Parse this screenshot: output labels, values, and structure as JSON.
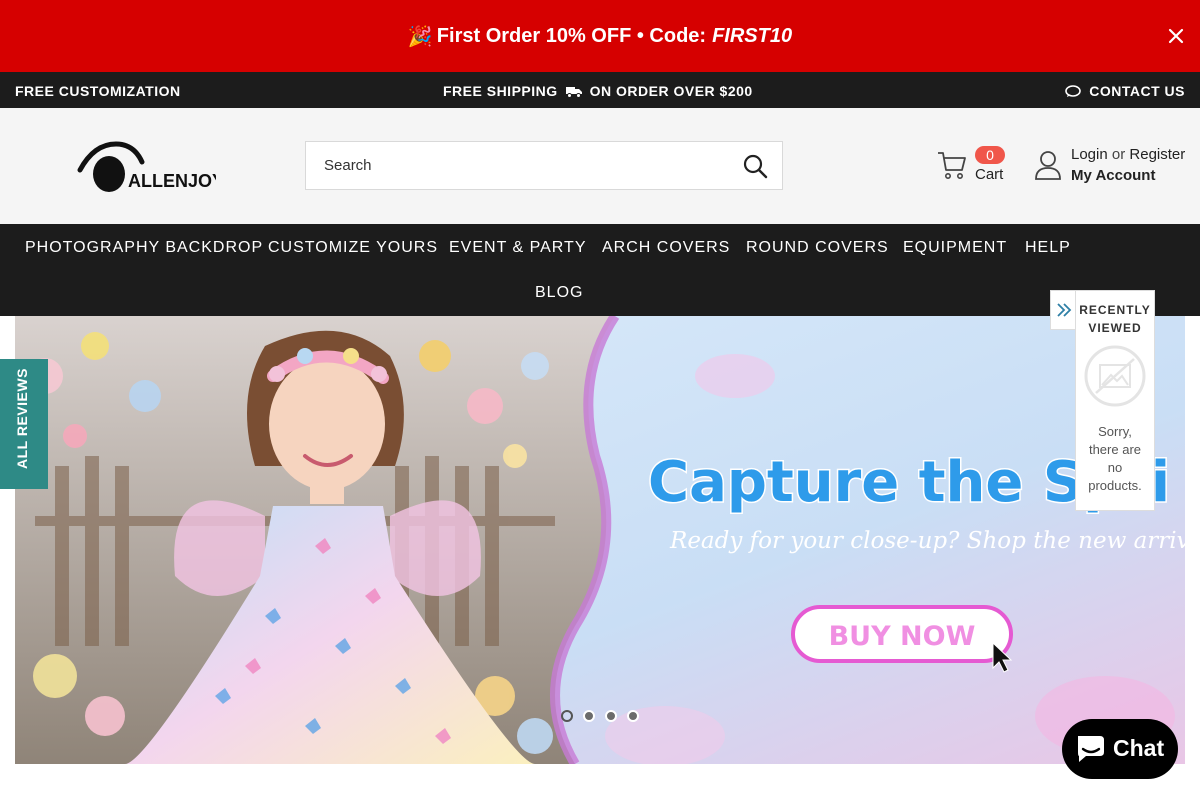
{
  "promo": {
    "emoji": "🎉",
    "text": "First Order 10% OFF • Code:",
    "code": "FIRST10",
    "bg_color": "#d60000"
  },
  "utility": {
    "left": "FREE CUSTOMIZATION",
    "center_a": "FREE SHIPPING",
    "center_b": "ON ORDER OVER $200",
    "right": "CONTACT US"
  },
  "header": {
    "logo_text": "ALLENJOY",
    "search_placeholder": "Search",
    "cart_count": "0",
    "cart_label": "Cart",
    "login": "Login",
    "or": "or",
    "register": "Register",
    "my_account": "My Account",
    "cart_badge_color": "#f0564a"
  },
  "nav": {
    "items": [
      "PHOTOGRAPHY BACKDROP",
      "CUSTOMIZE YOURS",
      "EVENT & PARTY",
      "ARCH COVERS",
      "ROUND COVERS",
      "EQUIPMENT",
      "HELP",
      "BLOG"
    ]
  },
  "hero": {
    "headline": "Capture the Spri",
    "subline": "Ready for your close-up? Shop the new arrivals.",
    "cta": "BUY NOW",
    "slide_count": 4,
    "active_slide": 1
  },
  "reviews_tab": {
    "label": "ALL REVIEWS",
    "color": "#2e8a86"
  },
  "recently_viewed": {
    "title_line1": "RECENTLY",
    "title_line2": "VIEWED",
    "empty_line1": "Sorry,",
    "empty_line2": "there are",
    "empty_line3": "no",
    "empty_line4": "products."
  },
  "chat": {
    "label": "Chat"
  }
}
